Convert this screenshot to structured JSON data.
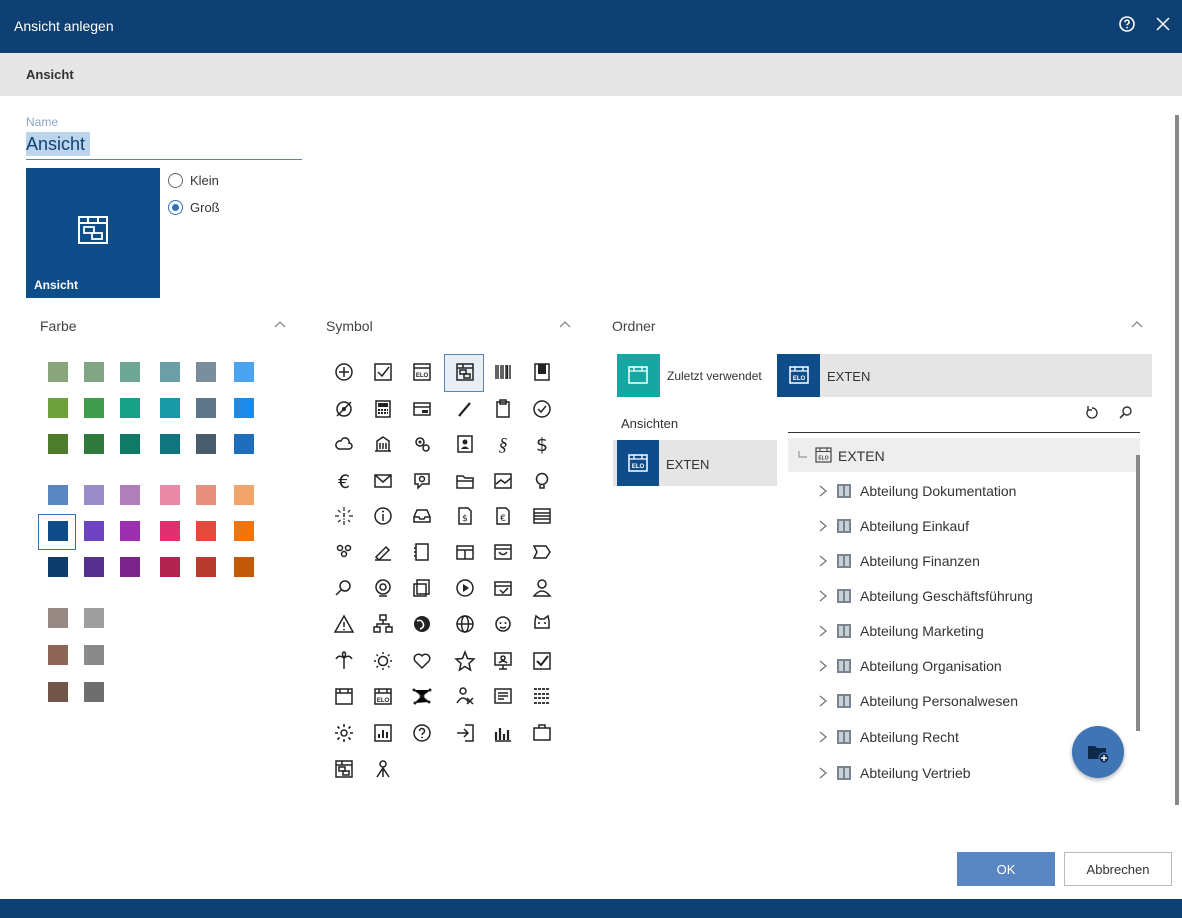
{
  "window": {
    "title": "Ansicht anlegen"
  },
  "section": {
    "label": "Ansicht"
  },
  "name_field": {
    "label": "Name",
    "value": "Ansicht"
  },
  "tile": {
    "label": "Ansicht",
    "color": "#0f4d8a"
  },
  "size_options": [
    {
      "label": "Klein",
      "selected": false
    },
    {
      "label": "Groß",
      "selected": true
    }
  ],
  "columns": {
    "farbe": "Farbe",
    "symbol": "Symbol",
    "ordner": "Ordner"
  },
  "colors": {
    "group1": [
      [
        "#8aa47c",
        "#7fa584",
        "#6da694",
        "#6b9ea5",
        "#7a8d9c",
        "#4aa3f0"
      ],
      [
        "#6ea13c",
        "#3e9c4c",
        "#17a186",
        "#1799a6",
        "#5e7689",
        "#1e8ae8"
      ],
      [
        "#4d7c2a",
        "#2f7a3c",
        "#117a66",
        "#11757f",
        "#4a5d6c",
        "#1f6dbb"
      ]
    ],
    "group2": [
      [
        "#5b86c4",
        "#9a8bc9",
        "#b07fb9",
        "#ea8aa8",
        "#e8907e",
        "#f2a56a"
      ],
      [
        "#0f4d8a",
        "#6e43c0",
        "#9b2fb0",
        "#e0306f",
        "#e54b3c",
        "#f0760c"
      ],
      [
        "#0e3d6b",
        "#55308f",
        "#7a238a",
        "#b3234f",
        "#b83a2e",
        "#c25a0a"
      ]
    ],
    "group3": [
      [
        "#978a85",
        "#9e9e9e"
      ],
      [
        "#8d6658",
        "#8a8a8a"
      ],
      [
        "#705548",
        "#6e6e6e"
      ]
    ],
    "selected": "#0f4d8a"
  },
  "folder": {
    "recent_label": "Zuletzt verwendet",
    "header_label": "EXTEN",
    "views_label": "Ansichten",
    "views_item": "EXTEN",
    "tree_root": "EXTEN",
    "tree_items": [
      "Abteilung Dokumentation",
      "Abteilung Einkauf",
      "Abteilung Finanzen",
      "Abteilung Geschäftsführung",
      "Abteilung Marketing",
      "Abteilung Organisation",
      "Abteilung Personalwesen",
      "Abteilung Recht",
      "Abteilung Vertrieb"
    ]
  },
  "buttons": {
    "ok": "OK",
    "cancel": "Abbrechen"
  }
}
